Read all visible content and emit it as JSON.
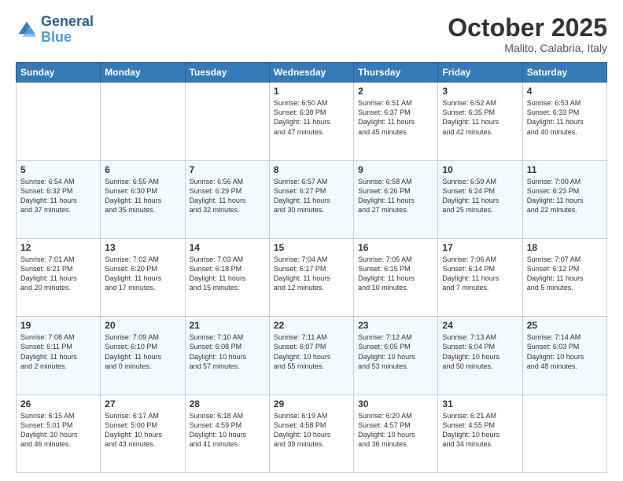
{
  "header": {
    "logo_line1": "General",
    "logo_line2": "Blue",
    "month": "October 2025",
    "location": "Malito, Calabria, Italy"
  },
  "weekdays": [
    "Sunday",
    "Monday",
    "Tuesday",
    "Wednesday",
    "Thursday",
    "Friday",
    "Saturday"
  ],
  "weeks": [
    [
      {
        "day": "",
        "info": ""
      },
      {
        "day": "",
        "info": ""
      },
      {
        "day": "",
        "info": ""
      },
      {
        "day": "1",
        "info": "Sunrise: 6:50 AM\nSunset: 6:38 PM\nDaylight: 11 hours\nand 47 minutes."
      },
      {
        "day": "2",
        "info": "Sunrise: 6:51 AM\nSunset: 6:37 PM\nDaylight: 11 hours\nand 45 minutes."
      },
      {
        "day": "3",
        "info": "Sunrise: 6:52 AM\nSunset: 6:35 PM\nDaylight: 11 hours\nand 42 minutes."
      },
      {
        "day": "4",
        "info": "Sunrise: 6:53 AM\nSunset: 6:33 PM\nDaylight: 11 hours\nand 40 minutes."
      }
    ],
    [
      {
        "day": "5",
        "info": "Sunrise: 6:54 AM\nSunset: 6:32 PM\nDaylight: 11 hours\nand 37 minutes."
      },
      {
        "day": "6",
        "info": "Sunrise: 6:55 AM\nSunset: 6:30 PM\nDaylight: 11 hours\nand 35 minutes."
      },
      {
        "day": "7",
        "info": "Sunrise: 6:56 AM\nSunset: 6:29 PM\nDaylight: 11 hours\nand 32 minutes."
      },
      {
        "day": "8",
        "info": "Sunrise: 6:57 AM\nSunset: 6:27 PM\nDaylight: 11 hours\nand 30 minutes."
      },
      {
        "day": "9",
        "info": "Sunrise: 6:58 AM\nSunset: 6:26 PM\nDaylight: 11 hours\nand 27 minutes."
      },
      {
        "day": "10",
        "info": "Sunrise: 6:59 AM\nSunset: 6:24 PM\nDaylight: 11 hours\nand 25 minutes."
      },
      {
        "day": "11",
        "info": "Sunrise: 7:00 AM\nSunset: 6:23 PM\nDaylight: 11 hours\nand 22 minutes."
      }
    ],
    [
      {
        "day": "12",
        "info": "Sunrise: 7:01 AM\nSunset: 6:21 PM\nDaylight: 11 hours\nand 20 minutes."
      },
      {
        "day": "13",
        "info": "Sunrise: 7:02 AM\nSunset: 6:20 PM\nDaylight: 11 hours\nand 17 minutes."
      },
      {
        "day": "14",
        "info": "Sunrise: 7:03 AM\nSunset: 6:18 PM\nDaylight: 11 hours\nand 15 minutes."
      },
      {
        "day": "15",
        "info": "Sunrise: 7:04 AM\nSunset: 6:17 PM\nDaylight: 11 hours\nand 12 minutes."
      },
      {
        "day": "16",
        "info": "Sunrise: 7:05 AM\nSunset: 6:15 PM\nDaylight: 11 hours\nand 10 minutes."
      },
      {
        "day": "17",
        "info": "Sunrise: 7:06 AM\nSunset: 6:14 PM\nDaylight: 11 hours\nand 7 minutes."
      },
      {
        "day": "18",
        "info": "Sunrise: 7:07 AM\nSunset: 6:12 PM\nDaylight: 11 hours\nand 5 minutes."
      }
    ],
    [
      {
        "day": "19",
        "info": "Sunrise: 7:08 AM\nSunset: 6:11 PM\nDaylight: 11 hours\nand 2 minutes."
      },
      {
        "day": "20",
        "info": "Sunrise: 7:09 AM\nSunset: 6:10 PM\nDaylight: 11 hours\nand 0 minutes."
      },
      {
        "day": "21",
        "info": "Sunrise: 7:10 AM\nSunset: 6:08 PM\nDaylight: 10 hours\nand 57 minutes."
      },
      {
        "day": "22",
        "info": "Sunrise: 7:11 AM\nSunset: 6:07 PM\nDaylight: 10 hours\nand 55 minutes."
      },
      {
        "day": "23",
        "info": "Sunrise: 7:12 AM\nSunset: 6:05 PM\nDaylight: 10 hours\nand 53 minutes."
      },
      {
        "day": "24",
        "info": "Sunrise: 7:13 AM\nSunset: 6:04 PM\nDaylight: 10 hours\nand 50 minutes."
      },
      {
        "day": "25",
        "info": "Sunrise: 7:14 AM\nSunset: 6:03 PM\nDaylight: 10 hours\nand 48 minutes."
      }
    ],
    [
      {
        "day": "26",
        "info": "Sunrise: 6:15 AM\nSunset: 5:01 PM\nDaylight: 10 hours\nand 46 minutes."
      },
      {
        "day": "27",
        "info": "Sunrise: 6:17 AM\nSunset: 5:00 PM\nDaylight: 10 hours\nand 43 minutes."
      },
      {
        "day": "28",
        "info": "Sunrise: 6:18 AM\nSunset: 4:59 PM\nDaylight: 10 hours\nand 41 minutes."
      },
      {
        "day": "29",
        "info": "Sunrise: 6:19 AM\nSunset: 4:58 PM\nDaylight: 10 hours\nand 39 minutes."
      },
      {
        "day": "30",
        "info": "Sunrise: 6:20 AM\nSunset: 4:57 PM\nDaylight: 10 hours\nand 36 minutes."
      },
      {
        "day": "31",
        "info": "Sunrise: 6:21 AM\nSunset: 4:55 PM\nDaylight: 10 hours\nand 34 minutes."
      },
      {
        "day": "",
        "info": ""
      }
    ]
  ]
}
